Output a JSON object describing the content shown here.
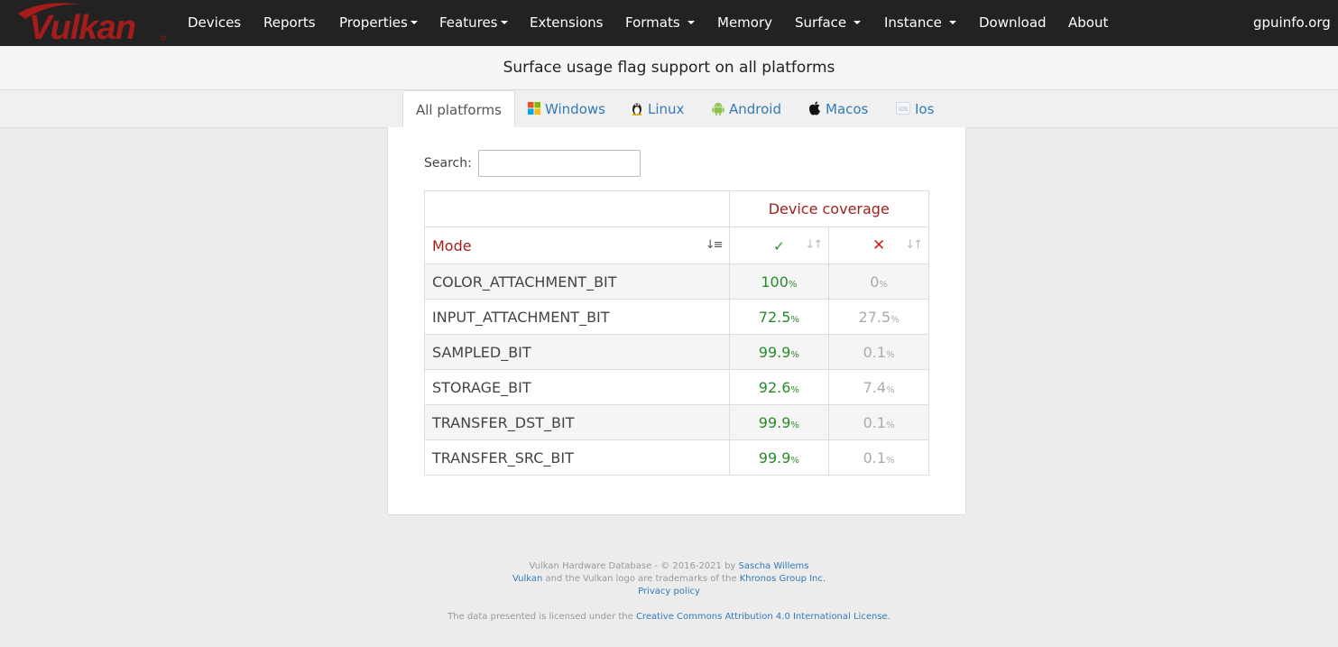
{
  "nav": {
    "logo_text": "Vulkan",
    "items": [
      "Devices",
      "Reports",
      "Properties",
      "Features",
      "Extensions",
      "Formats",
      "Memory",
      "Surface",
      "Instance",
      "Download",
      "About"
    ],
    "site": "gpuinfo.org"
  },
  "page": {
    "title": "Surface usage flag support on all platforms"
  },
  "tabs": [
    "All platforms",
    "Windows",
    "Linux",
    "Android",
    "Macos",
    "Ios"
  ],
  "search": {
    "label": "Search:",
    "value": ""
  },
  "table": {
    "group_header": "Device coverage",
    "mode_header": "Mode",
    "supported_symbol": "✓",
    "unsupported_symbol": "✕",
    "pct_unit": "%",
    "rows": [
      {
        "mode": "COLOR_ATTACHMENT_BIT",
        "supported": "100",
        "unsupported": "0"
      },
      {
        "mode": "INPUT_ATTACHMENT_BIT",
        "supported": "72.5",
        "unsupported": "27.5"
      },
      {
        "mode": "SAMPLED_BIT",
        "supported": "99.9",
        "unsupported": "0.1"
      },
      {
        "mode": "STORAGE_BIT",
        "supported": "92.6",
        "unsupported": "7.4"
      },
      {
        "mode": "TRANSFER_DST_BIT",
        "supported": "99.9",
        "unsupported": "0.1"
      },
      {
        "mode": "TRANSFER_SRC_BIT",
        "supported": "99.9",
        "unsupported": "0.1"
      }
    ]
  },
  "footer": {
    "line1_prefix": "Vulkan Hardware Database - © 2016-2021 by ",
    "author": "Sascha Willems",
    "line2_link1": "Vulkan",
    "line2_mid": " and the Vulkan logo are trademarks of the ",
    "line2_link2": "Khronos Group Inc.",
    "privacy": "Privacy policy",
    "license_prefix": "The data presented is licensed under the ",
    "license_link": "Creative Commons Attribution 4.0 International License."
  },
  "colors": {
    "navbar": "#222222",
    "brand_red": "#a02020",
    "link_blue": "#337ab7",
    "supported_green": "#2a8a2a",
    "unsupported_gray": "#aaaaaa"
  }
}
